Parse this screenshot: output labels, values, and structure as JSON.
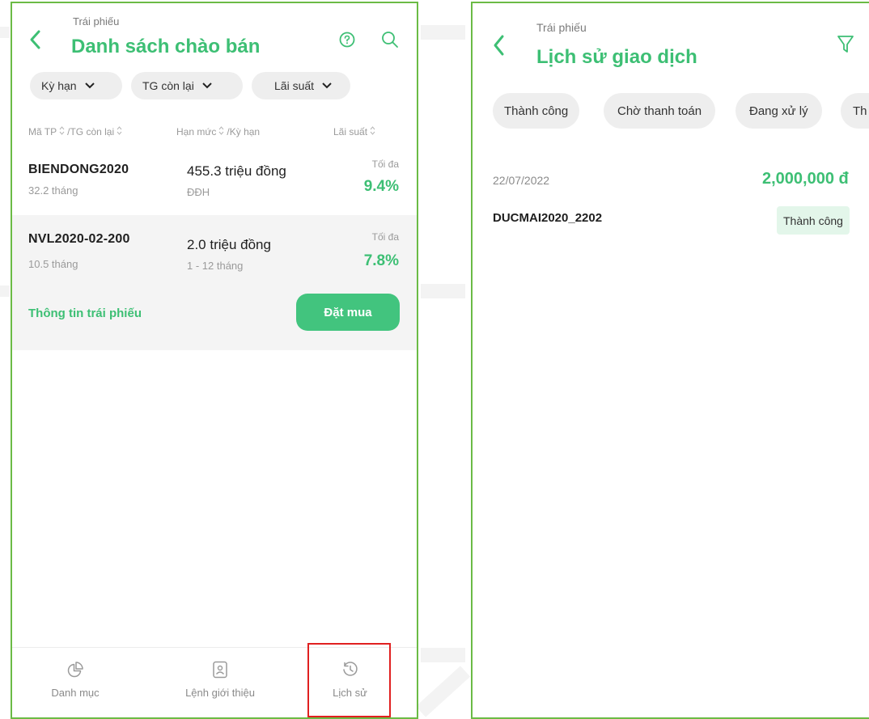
{
  "left_screen": {
    "header": {
      "section": "Trái phiếu",
      "title": "Danh sách chào bán"
    },
    "icons": {
      "back": "chevron-left-icon",
      "help": "question-circle-icon",
      "search": "search-icon"
    },
    "filters": [
      {
        "label": "Kỳ hạn"
      },
      {
        "label": "TG còn lại"
      },
      {
        "label": "Lãi suất"
      }
    ],
    "columns": {
      "code": "Mã TP",
      "remaining": "/TG còn lại",
      "limit": "Hạn mức",
      "term": "/Kỳ hạn",
      "rate": "Lãi suất"
    },
    "bonds": [
      {
        "code": "BIENDONG2020",
        "remaining": "32.2 tháng",
        "amount": "455.3 triệu đồng",
        "term": "ĐĐH",
        "rate_label": "Tối đa",
        "rate": "9.4%"
      },
      {
        "code": "NVL2020-02-200",
        "remaining": "10.5 tháng",
        "amount": "2.0 triệu đồng",
        "term": "1 - 12 tháng",
        "rate_label": "Tối đa",
        "rate": "7.8%"
      }
    ],
    "selected_actions": {
      "info_link": "Thông tin trái phiếu",
      "buy_button": "Đặt mua"
    },
    "bottom_nav": [
      {
        "label": "Danh mục",
        "icon": "pie-chart-icon"
      },
      {
        "label": "Lệnh giới thiệu",
        "icon": "document-user-icon"
      },
      {
        "label": "Lịch sử",
        "icon": "history-icon"
      }
    ]
  },
  "right_screen": {
    "header": {
      "section": "Trái phiếu",
      "title": "Lịch sử giao dịch"
    },
    "icons": {
      "back": "chevron-left-icon",
      "filter": "filter-icon"
    },
    "status_tabs": [
      {
        "label": "Thành công"
      },
      {
        "label": "Chờ thanh toán"
      },
      {
        "label": "Đang xử lý"
      },
      {
        "label": "Th"
      }
    ],
    "transactions": [
      {
        "date": "22/07/2022",
        "amount": "2,000,000 đ",
        "code": "DUCMAI2020_2202",
        "status": "Thành công"
      }
    ]
  },
  "colors": {
    "accent": "#3dbf74",
    "border": "#6bbb45",
    "highlight": "#e02020",
    "selected_row_bg": "#f4f4f4"
  }
}
